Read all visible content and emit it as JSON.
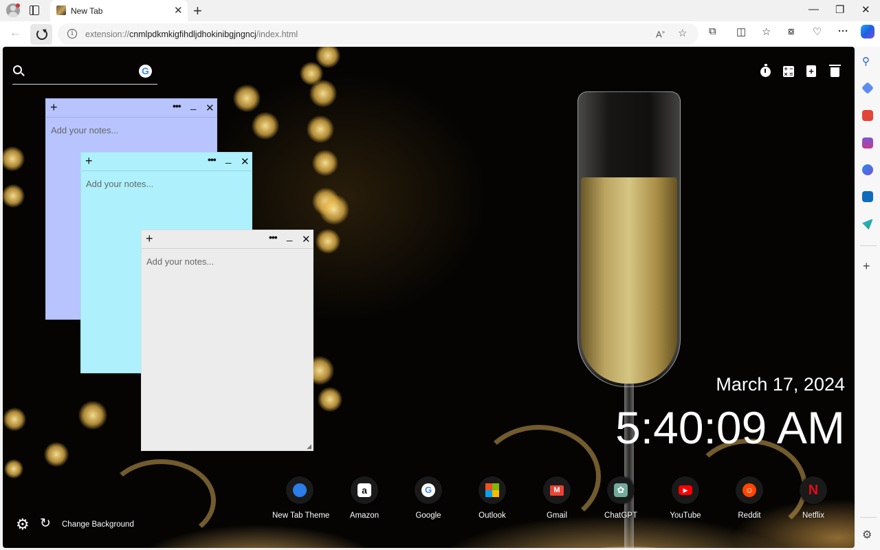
{
  "browser": {
    "tab_title": "New Tab",
    "tab_close_glyph": "✕",
    "new_tab_glyph": "+",
    "window_controls": [
      "—",
      "❐",
      "✕"
    ],
    "url_scheme": "extension://",
    "url_host": "cnmlpdkmkigfihdljdhokinibgjngncj",
    "url_path": "/index.html",
    "omnibox_icons": [
      "read-aloud-icon",
      "favorite-star-icon"
    ],
    "toolbar_icons": [
      "extensions-icon",
      "split-screen-icon",
      "favorites-icon",
      "collections-icon",
      "browser-essentials-icon",
      "more-icon",
      "copilot-icon"
    ],
    "sidebar_icons": [
      "search-icon",
      "shopping-tag-icon",
      "tools-icon",
      "games-icon",
      "microsoft365-icon",
      "outlook-icon",
      "send-icon",
      "add-icon",
      "settings-icon"
    ]
  },
  "search": {
    "placeholder": "",
    "engine_icon": "google-icon",
    "engine_letter": "G"
  },
  "top_tools": [
    "timer-icon",
    "calculator-icon",
    "add-note-icon",
    "trash-icon"
  ],
  "notes": [
    {
      "placeholder": "Add your notes...",
      "color": "#b8c4fe"
    },
    {
      "placeholder": "Add your notes...",
      "color": "#aef1fc"
    },
    {
      "placeholder": "Add your notes...",
      "color": "#ececec"
    }
  ],
  "note_controls": {
    "add": "+",
    "more": "•••",
    "minimize": "_",
    "close": "✕"
  },
  "datetime": {
    "date": "March 17, 2024",
    "time": "5:40:09 AM"
  },
  "shortcuts": [
    {
      "label": "New Tab Theme",
      "icon": "new-tab-theme-icon",
      "color": "#2b7de9"
    },
    {
      "label": "Amazon",
      "icon": "amazon-icon",
      "color": "#ffffff"
    },
    {
      "label": "Google",
      "icon": "google-icon",
      "color": "#ffffff"
    },
    {
      "label": "Outlook",
      "icon": "outlook-icon",
      "color": "#f25022"
    },
    {
      "label": "Gmail",
      "icon": "gmail-icon",
      "color": "#ea4335"
    },
    {
      "label": "ChatGPT",
      "icon": "chatgpt-icon",
      "color": "#74aa9c"
    },
    {
      "label": "YouTube",
      "icon": "youtube-icon",
      "color": "#ff0000"
    },
    {
      "label": "Reddit",
      "icon": "reddit-icon",
      "color": "#ff4500"
    },
    {
      "label": "Netflix",
      "icon": "netflix-icon",
      "color": "#e50914"
    }
  ],
  "bottom_bar": {
    "change_background": "Change Background"
  }
}
